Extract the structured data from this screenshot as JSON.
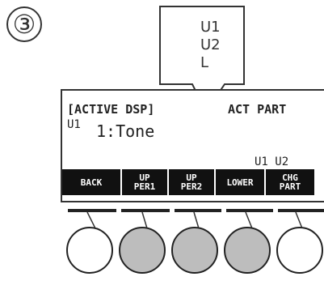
{
  "step_number": "③",
  "callout": {
    "lines": [
      "U1",
      "U2",
      "L"
    ]
  },
  "lcd": {
    "header_left": "[ACTIVE DSP]",
    "header_right": "ACT PART",
    "part_label": "U1",
    "tone_value": "1:Tone",
    "active_parts": "U1 U2",
    "softkeys": [
      {
        "line1": "BACK",
        "line2": ""
      },
      {
        "line1": "UP",
        "line2": "PER1"
      },
      {
        "line1": "UP",
        "line2": "PER2"
      },
      {
        "line1": "LOWER",
        "line2": ""
      },
      {
        "line1": "CHG",
        "line2": "PART"
      }
    ]
  },
  "buttons": [
    {
      "name": "back",
      "state": "unpressed"
    },
    {
      "name": "upper1",
      "state": "pressed"
    },
    {
      "name": "upper2",
      "state": "pressed"
    },
    {
      "name": "lower",
      "state": "pressed"
    },
    {
      "name": "change-part",
      "state": "unpressed"
    }
  ],
  "colors": {
    "pressed": "#bdbdbd",
    "key_bg": "#111111",
    "line": "#333333"
  }
}
